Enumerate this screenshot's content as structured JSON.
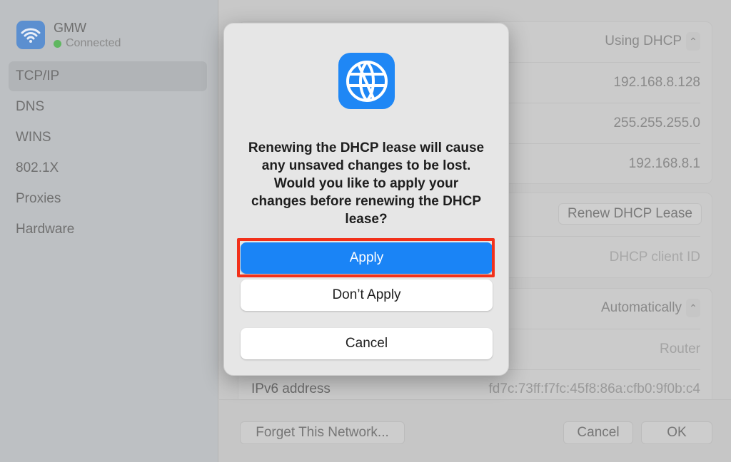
{
  "sidebar": {
    "network_name": "GMW",
    "status": "Connected",
    "items": [
      {
        "label": "TCP/IP",
        "selected": true
      },
      {
        "label": "DNS"
      },
      {
        "label": "WINS"
      },
      {
        "label": "802.1X"
      },
      {
        "label": "Proxies"
      },
      {
        "label": "Hardware"
      }
    ]
  },
  "main": {
    "configure_ipv4": "Using DHCP",
    "ip_address": "192.168.8.128",
    "subnet_mask": "255.255.255.0",
    "router": "192.168.8.1",
    "renew_button": "Renew DHCP Lease",
    "dhcp_client_id_placeholder": "DHCP client ID",
    "configure_ipv6": "Automatically",
    "ipv6_router_placeholder": "Router",
    "ipv6_address_label": "IPv6 address",
    "ipv6_address": "fd7c:73ff:f7fc:45f8:86a:cfb0:9f0b:c4"
  },
  "footer": {
    "forget": "Forget This Network...",
    "cancel": "Cancel",
    "ok": "OK"
  },
  "dialog": {
    "message": "Renewing the DHCP lease will cause any unsaved changes to be lost. Would you like to apply your changes before renewing the DHCP lease?",
    "apply": "Apply",
    "dont_apply": "Don’t Apply",
    "cancel": "Cancel"
  },
  "colors": {
    "accent": "#1a84f6",
    "highlight": "#f2311b",
    "connected": "#5fb760"
  }
}
